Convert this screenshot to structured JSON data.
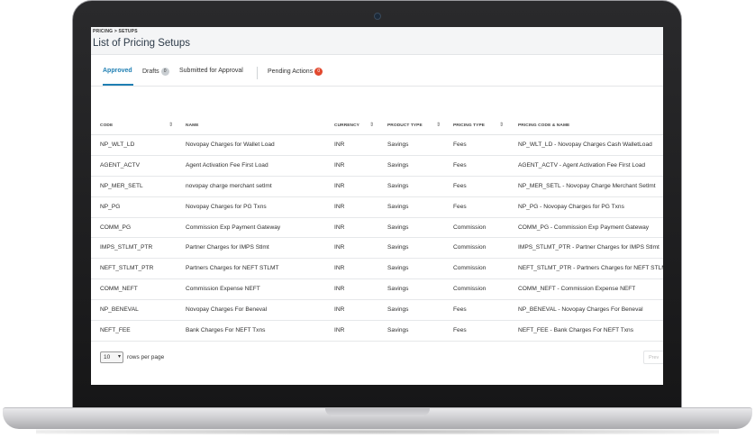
{
  "header": {
    "breadcrumb": "PRICING > SETUPS",
    "title": "List of Pricing Setups"
  },
  "tabs": [
    {
      "label": "Approved",
      "active": true
    },
    {
      "label": "Drafts",
      "badge": "0"
    },
    {
      "label": "Submitted for Approval"
    },
    {
      "label": "Pending Actions",
      "badge": "0"
    }
  ],
  "table": {
    "columns": [
      "CODE",
      "NAME",
      "CURRENCY",
      "PRODUCT TYPE",
      "PRICING TYPE",
      "PRICING CODE & NAME"
    ],
    "rows": [
      [
        "NP_WLT_LD",
        "Novopay Charges for Wallet Load",
        "INR",
        "Savings",
        "Fees",
        "NP_WLT_LD - Novopay Charges Cash WalletLoad"
      ],
      [
        "AGENT_ACTV",
        "Agent Activation Fee First Load",
        "INR",
        "Savings",
        "Fees",
        "AGENT_ACTV - Agent Activation Fee First Load"
      ],
      [
        "NP_MER_SETL",
        "novopay charge merchant setlmt",
        "INR",
        "Savings",
        "Fees",
        "NP_MER_SETL - Novopay Charge Merchant Setlmt"
      ],
      [
        "NP_PG",
        "Novopay Charges for PG Txns",
        "INR",
        "Savings",
        "Fees",
        "NP_PG - Novopay Charges for PG Txns"
      ],
      [
        "COMM_PG",
        "Commission Exp Payment Gateway",
        "INR",
        "Savings",
        "Commission",
        "COMM_PG - Commission Exp Payment Gateway"
      ],
      [
        "IMPS_STLMT_PTR",
        "Partner Charges for IMPS Stlmt",
        "INR",
        "Savings",
        "Commission",
        "IMPS_STLMT_PTR - Partner Charges for IMPS Stlmt"
      ],
      [
        "NEFT_STLMT_PTR",
        "Partners Charges for NEFT STLMT",
        "INR",
        "Savings",
        "Commission",
        "NEFT_STLMT_PTR - Partners Charges for NEFT STLMT"
      ],
      [
        "COMM_NEFT",
        "Commission Expense NEFT",
        "INR",
        "Savings",
        "Commission",
        "COMM_NEFT - Commission Expense NEFT"
      ],
      [
        "NP_BENEVAL",
        "Novopay Charges For Beneval",
        "INR",
        "Savings",
        "Fees",
        "NP_BENEVAL - Novopay Charges For Beneval"
      ],
      [
        "NEFT_FEE",
        "Bank Charges For NEFT Txns",
        "INR",
        "Savings",
        "Fees",
        "NEFT_FEE - Bank Charges For NEFT Txns"
      ]
    ]
  },
  "pagination": {
    "rows_per_page_value": "10",
    "rows_per_page_label": "rows per page",
    "pager_partial": "Prev"
  },
  "colors": {
    "accent": "#1f7fb3",
    "badge_red": "#e2492f"
  }
}
